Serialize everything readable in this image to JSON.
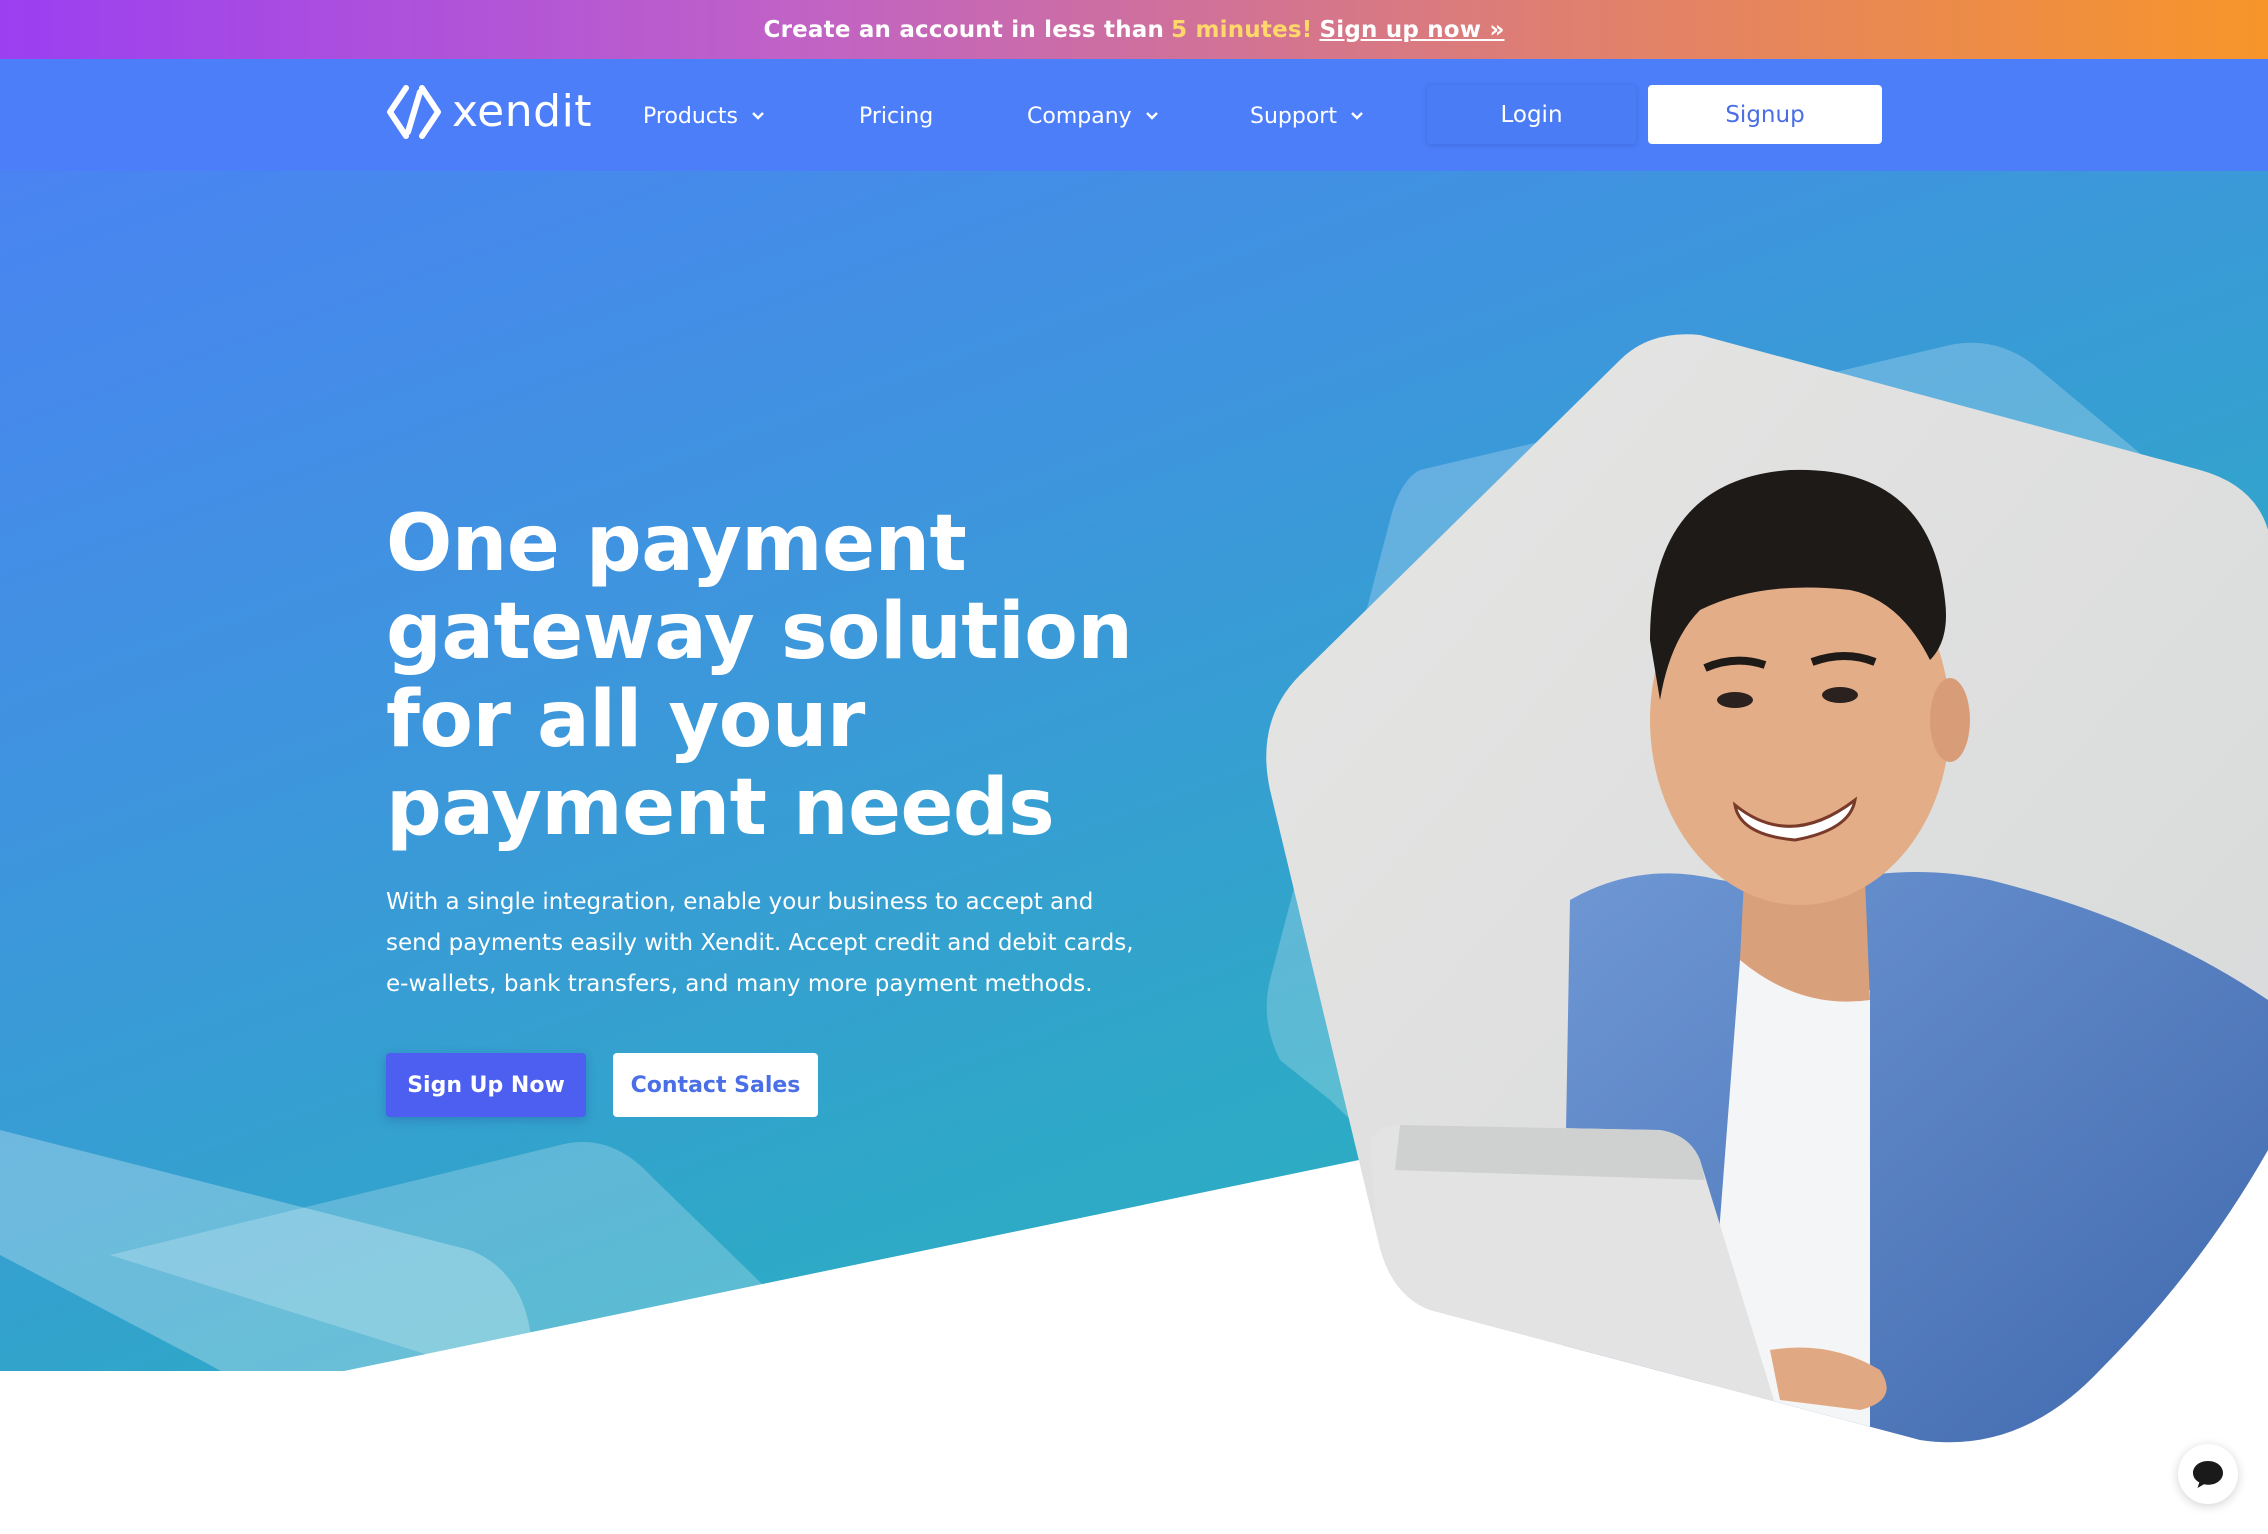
{
  "promo": {
    "text": "Create an account in less than",
    "highlight": "5 minutes!",
    "link": "Sign up now »"
  },
  "nav": {
    "logo": "xendit",
    "items": [
      {
        "label": "Products",
        "dropdown": true
      },
      {
        "label": "Pricing",
        "dropdown": false
      },
      {
        "label": "Company",
        "dropdown": true
      },
      {
        "label": "Support",
        "dropdown": true
      }
    ],
    "login": "Login",
    "signup": "Signup"
  },
  "hero": {
    "headline_lines": [
      "One payment",
      "gateway solution",
      "for all your",
      "payment needs"
    ],
    "subtext": "With a single integration, enable your business to accept and send payments easily with Xendit. Accept credit and debit cards, e-wallets, bank transfers, and many more payment methods.",
    "primary_cta": "Sign Up Now",
    "secondary_cta": "Contact Sales"
  },
  "colors": {
    "promo_start": "#9b3ff1",
    "promo_end": "#f7952a",
    "promo_highlight": "#ffd76a",
    "nav_bg": "#4d7ef9",
    "hero_start": "#4a84f2",
    "hero_end": "#26b9bb",
    "primary_button": "#4c5ff0",
    "link_text": "#4a6ee6"
  },
  "icons": {
    "logo": "xendit-logo-icon",
    "dropdown": "chevron-down-icon",
    "chat": "chat-bubble-icon"
  }
}
